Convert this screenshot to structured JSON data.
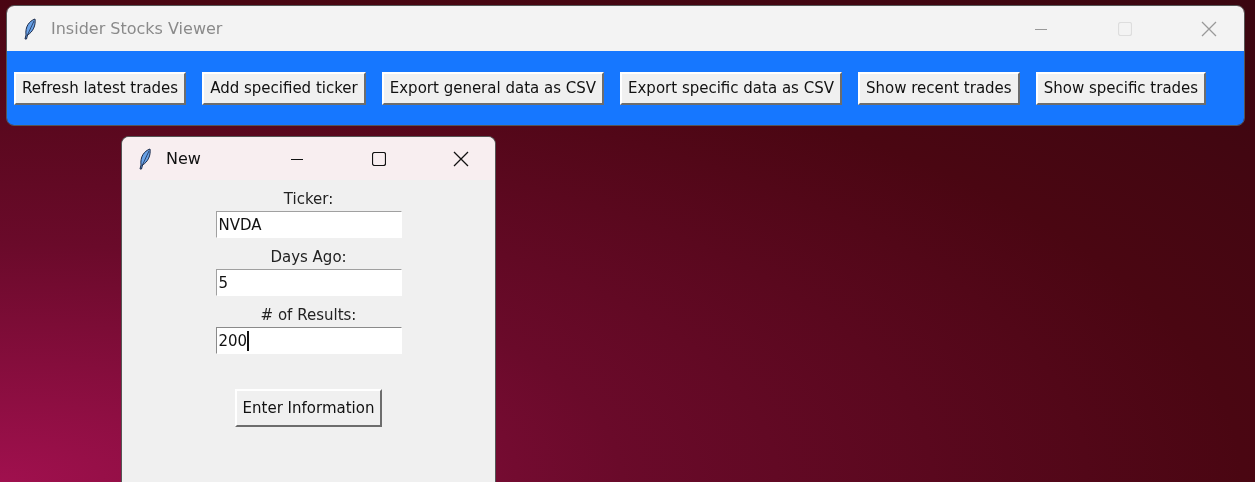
{
  "main_window": {
    "title": "Insider Stocks Viewer",
    "active": false,
    "maximize_disabled": true,
    "buttons": [
      "Refresh latest trades",
      "Add specified ticker",
      "Export general data as CSV",
      "Export specific data as CSV",
      "Show recent trades",
      "Show specific trades"
    ]
  },
  "dialog": {
    "title": "New",
    "active": true,
    "maximize_disabled": false,
    "form": [
      {
        "kind": "label",
        "text": "Ticker:"
      },
      {
        "kind": "field",
        "value": "NVDA",
        "focused": false
      },
      {
        "kind": "label",
        "text": "Days Ago:"
      },
      {
        "kind": "field",
        "value": "5",
        "focused": false
      },
      {
        "kind": "label",
        "text": "# of Results:"
      },
      {
        "kind": "field",
        "value": "200",
        "focused": true
      }
    ],
    "button": "Enter Information"
  }
}
